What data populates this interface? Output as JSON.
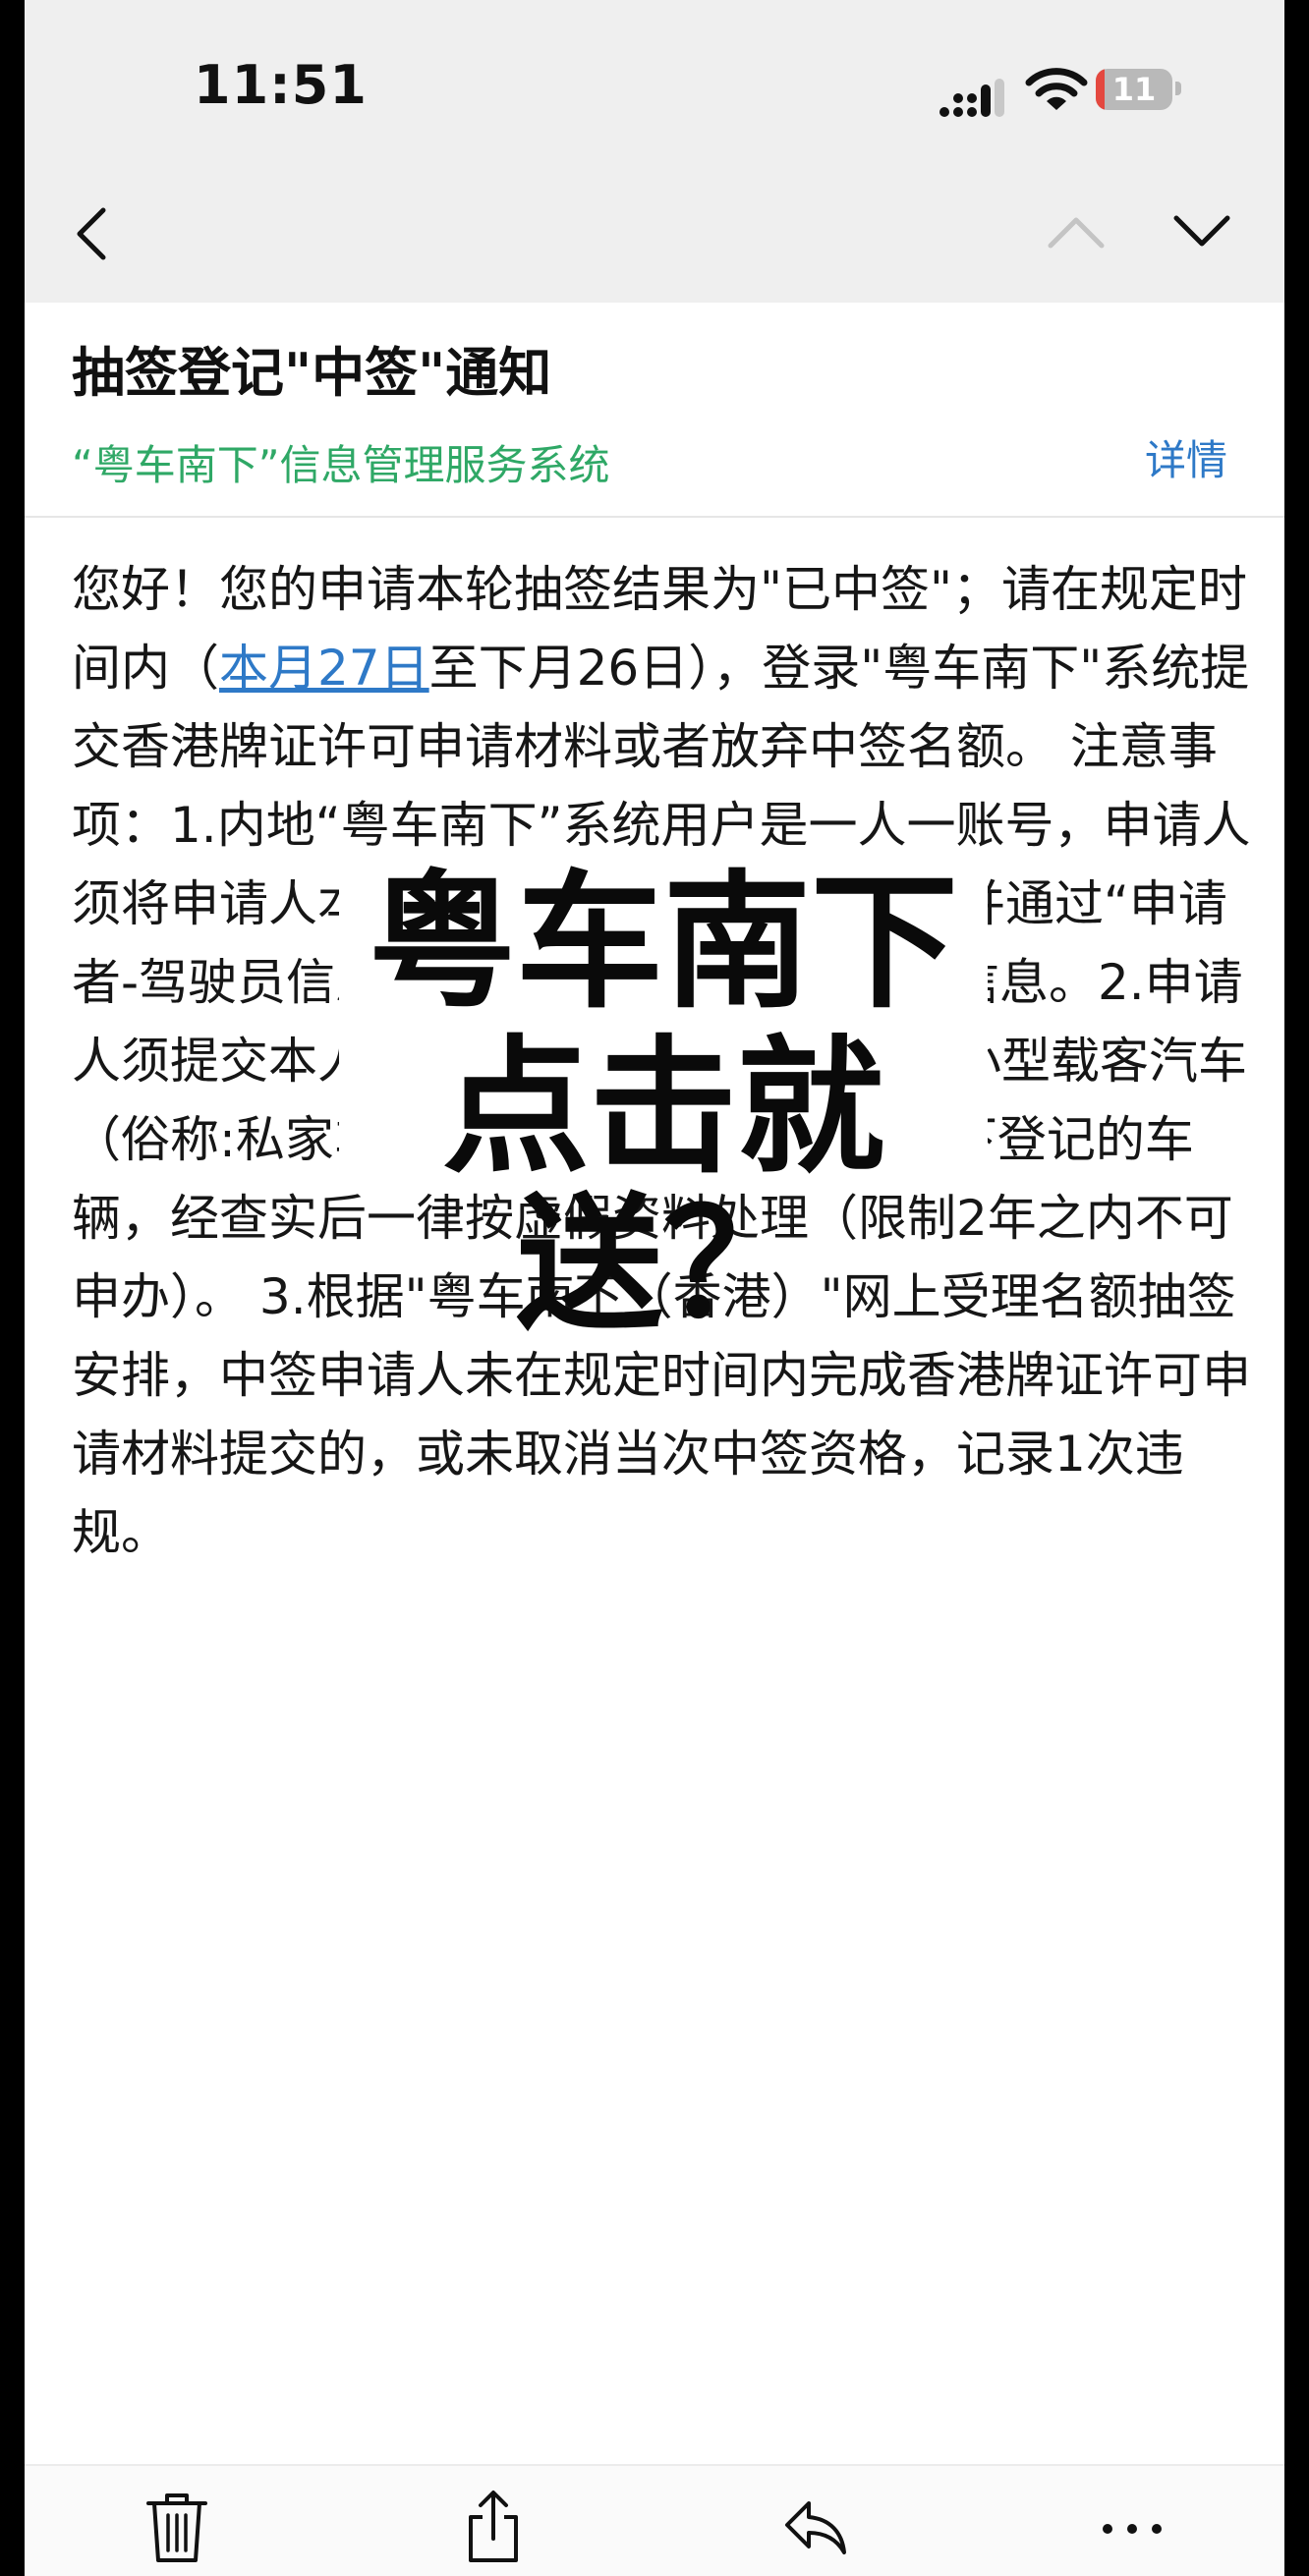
{
  "status_bar": {
    "time": "11:51",
    "battery": "11",
    "battery_level": 0.11
  },
  "nav": {
    "back": "chevron-left-icon",
    "prev": "chevron-up-icon",
    "next": "chevron-down-icon"
  },
  "email": {
    "subject": "抽签登记\"中签\"通知",
    "sender": "“粤车南下”信息管理服务系统",
    "details_label": "详情",
    "body_before_link": "您好！您的申请本轮抽签结果为\"已中签\"；请在规定时间内（",
    "body_link": "本月27日",
    "body_after_link": "至下月26日），登录\"粤车南下\"系统提交香港牌证许可申请材料或者放弃中签名额。 注意事项：1.内地“粤车南下”系统用户是一人一账号，申请人须将申请人本人作为车辆备案指定司机，并通过“申请者-驾驶员信息”如实填写本人的证件资料信息。2.申请人须提交本人名下登记的广东省\"非运营\"小型载客汽车（俗称:私家车）；假如填报他人或公司名下登记的车辆，经查实后一律按虚假资料处理（限制2年之内不可申办）。 3.根据\"粤车南下（香港）\"网上受理名额抽签安排，中签申请人未在规定时间内完成香港牌证许可申请材料提交的，或未取消当次中签资格，记录1次违规。"
  },
  "overlay": {
    "line1": "粤车南下",
    "line2": "点击就送？"
  },
  "toolbar": {
    "icons": [
      "trash-icon",
      "share-icon",
      "reply-icon",
      "more-icon"
    ]
  },
  "colors": {
    "sender_green": "#2fa866",
    "link_blue": "#2e79c7",
    "battery_red": "#e4483f"
  }
}
